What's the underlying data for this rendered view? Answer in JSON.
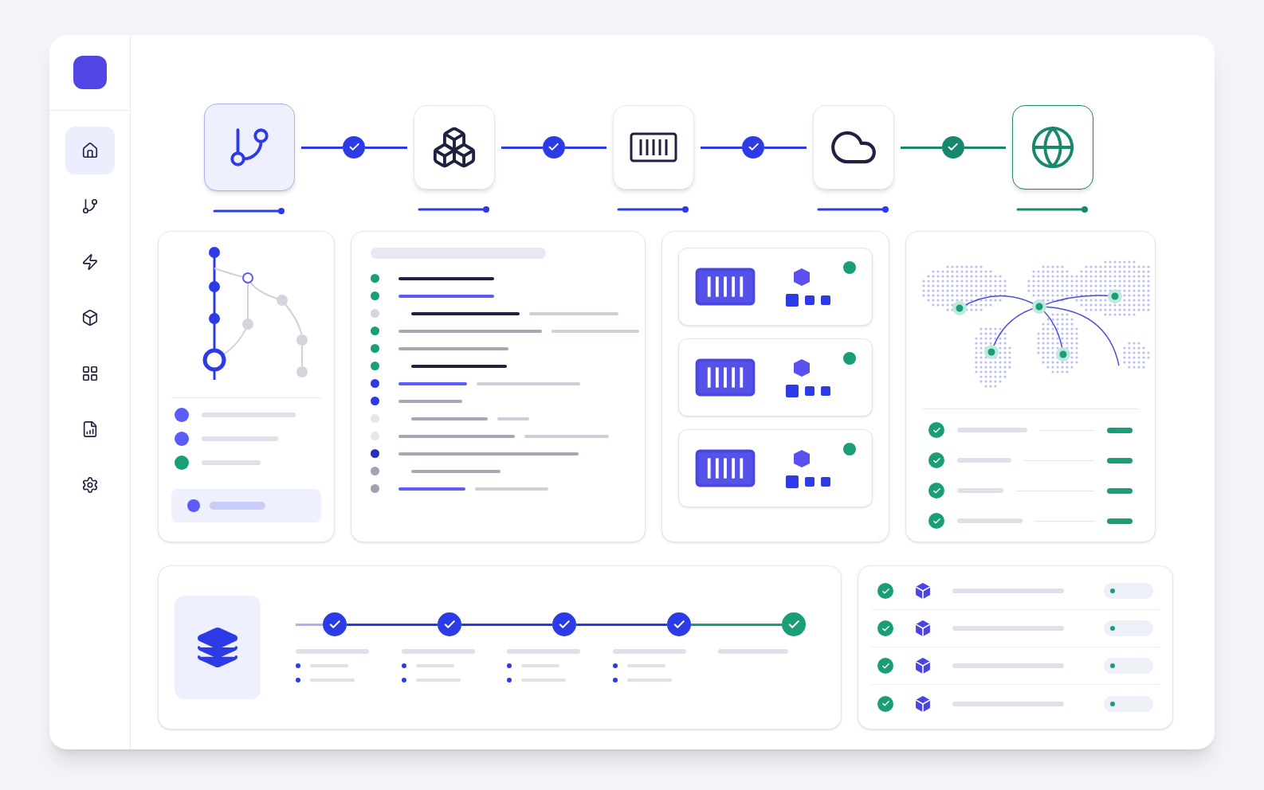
{
  "sidebar": {
    "items": [
      {
        "kind": "home",
        "selected": true
      },
      {
        "kind": "branch",
        "selected": false
      },
      {
        "kind": "bolt",
        "selected": false
      },
      {
        "kind": "box",
        "selected": false
      },
      {
        "kind": "grid",
        "selected": false
      },
      {
        "kind": "chart",
        "selected": false
      },
      {
        "kind": "settings",
        "selected": false
      }
    ]
  },
  "pipeline": {
    "stages": [
      {
        "kind": "branch",
        "selected": true,
        "outlined": false,
        "color": "#2d3be6"
      },
      {
        "kind": "cubes",
        "selected": false,
        "outlined": false,
        "color": "#2d3be6"
      },
      {
        "kind": "container",
        "selected": false,
        "outlined": false,
        "color": "#2d3be6"
      },
      {
        "kind": "cloud",
        "selected": false,
        "outlined": false,
        "color": "#2d3be6"
      },
      {
        "kind": "globe",
        "selected": false,
        "outlined": true,
        "color": "#17876d"
      }
    ],
    "links": [
      {
        "color": "#2d3be6"
      },
      {
        "color": "#2d3be6"
      },
      {
        "color": "#2d3be6"
      },
      {
        "color": "#17876d"
      }
    ]
  },
  "branches": {
    "legend": [
      {
        "color": "#5b5bf5"
      },
      {
        "color": "#5b5bf5"
      },
      {
        "color": "#1a9e78"
      }
    ]
  },
  "log": {
    "rows": [
      {
        "color": "#1a9e78"
      },
      {
        "color": "#1a9e78"
      },
      {
        "color": "#d4d6de"
      },
      {
        "color": "#1a9e78"
      },
      {
        "color": "#1a9e78"
      },
      {
        "color": "#1a9e78"
      },
      {
        "color": "#2d3be6"
      },
      {
        "color": "#2d3be6"
      },
      {
        "color": "#e4e6ec"
      },
      {
        "color": "#e4e6ec"
      },
      {
        "color": "#2a2fb8"
      },
      {
        "color": "#9ea2b3"
      },
      {
        "color": "#9ea2b3"
      }
    ]
  },
  "containers": [
    {
      "color": "#1a9e78"
    },
    {
      "color": "#1a9e78"
    },
    {
      "color": "#1a9e78"
    }
  ],
  "regions": {
    "checks": [
      {
        "color": "#1a9e78"
      },
      {
        "color": "#1a9e78"
      },
      {
        "color": "#1a9e78"
      },
      {
        "color": "#1a9e78"
      }
    ]
  },
  "rollout": {
    "steps": [
      {
        "color": "#2d3be6"
      },
      {
        "color": "#2d3be6"
      },
      {
        "color": "#2d3be6"
      },
      {
        "color": "#2d3be6"
      },
      {
        "color": "#1a9e78"
      }
    ]
  },
  "nodes": [
    {
      "color": "#1a9e78"
    },
    {
      "color": "#1a9e78"
    },
    {
      "color": "#1a9e78"
    },
    {
      "color": "#1a9e78"
    }
  ]
}
